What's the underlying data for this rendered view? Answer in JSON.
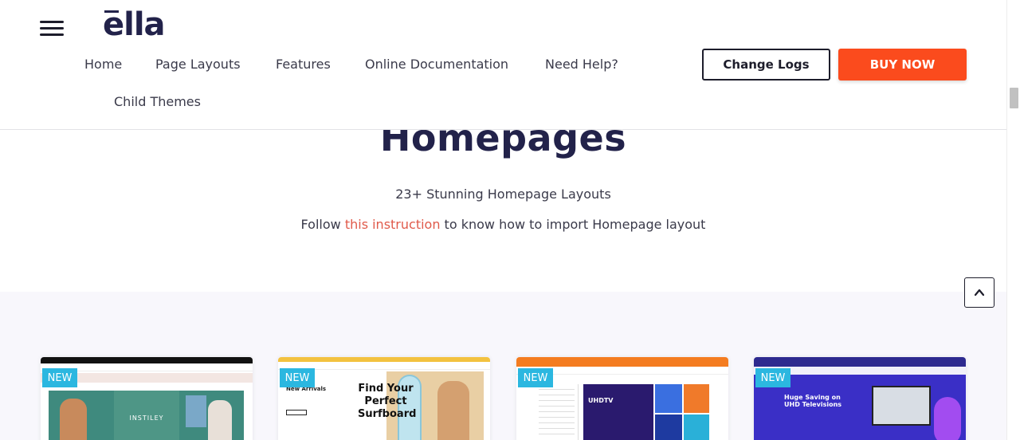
{
  "header": {
    "logo": "ella",
    "nav": [
      "Home",
      "Page Layouts",
      "Features",
      "Online Documentation",
      "Need Help?",
      "Child Themes"
    ],
    "change_logs": "Change Logs",
    "buy_now": "BUY NOW"
  },
  "hero": {
    "title": "Homepages",
    "subtitle": "23+ Stunning Homepage Layouts",
    "follow_prefix": "Follow ",
    "follow_link": "this instruction",
    "follow_suffix": " to know how to import Homepage layout"
  },
  "gallery": {
    "badge": "NEW",
    "cards": [
      {
        "preview_text": "INSTILEY"
      },
      {
        "preview_title": "Find Your Perfect Surfboard",
        "preview_sub": "New Arrivals"
      },
      {
        "preview_text": "UHDTV"
      },
      {
        "preview_text": "Huge Saving on UHD Televisions"
      }
    ]
  },
  "colors": {
    "accent": "#fb4b1d",
    "brand": "#22224a",
    "link": "#e05a4a",
    "badge": "#2bb7e0"
  }
}
